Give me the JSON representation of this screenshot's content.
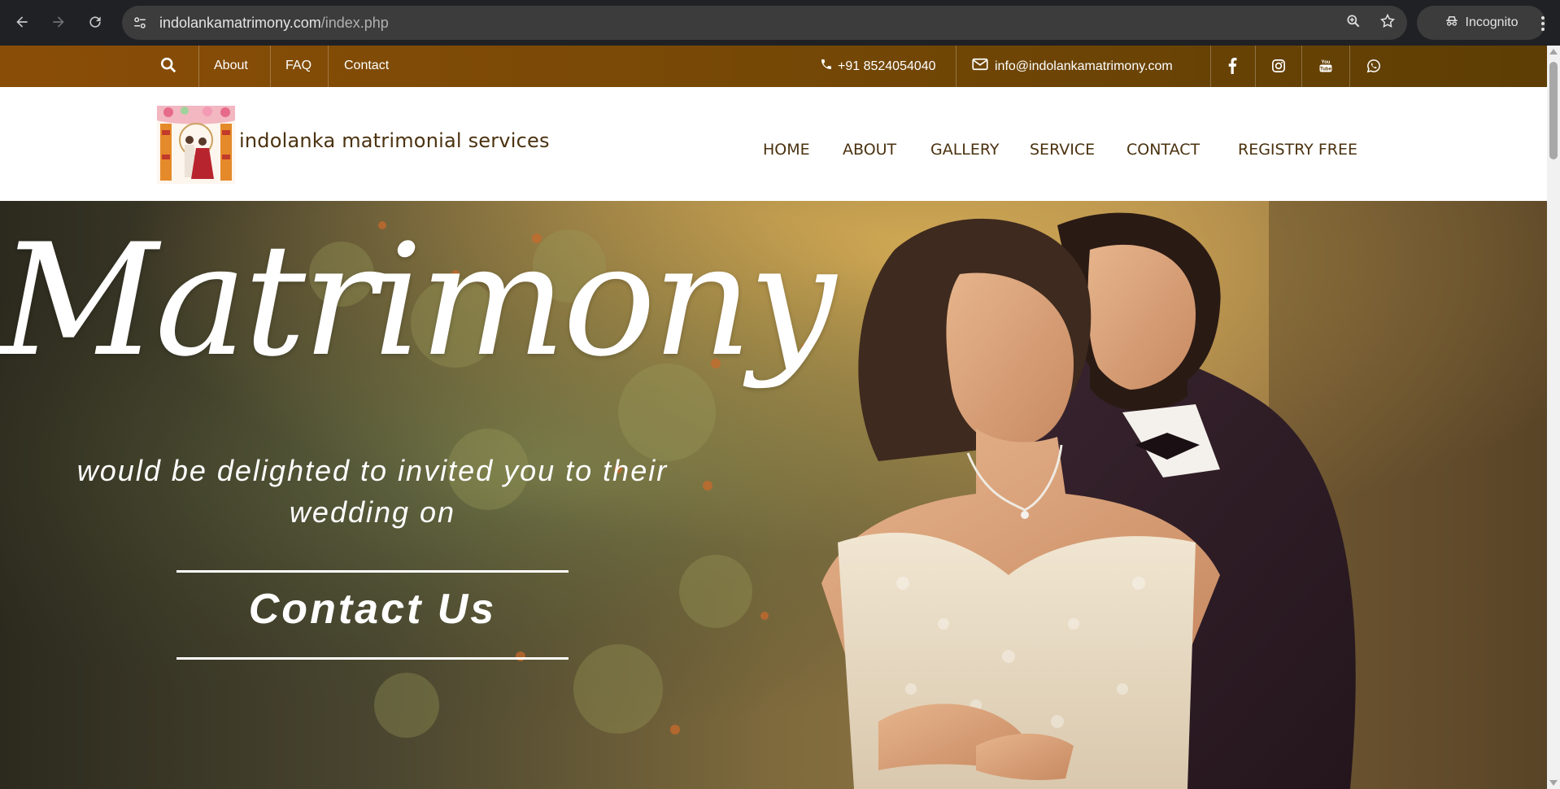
{
  "browser": {
    "url_domain": "indolankamatrimony.com",
    "url_path": "/index.php",
    "incognito_label": "Incognito",
    "icons": [
      "back-icon",
      "forward-icon",
      "reload-icon",
      "site-info-icon",
      "zoom-icon",
      "bookmark-star-icon",
      "incognito-icon",
      "kebab-menu-icon"
    ]
  },
  "topbar": {
    "links": [
      "About",
      "FAQ",
      "Contact"
    ],
    "phone": "+91 8524054040",
    "email": "info@indolankamatrimony.com",
    "social": [
      "facebook-icon",
      "instagram-icon",
      "youtube-icon",
      "whatsapp-icon"
    ],
    "colors": {
      "start": "#8a4d07",
      "end": "#5e3e04"
    }
  },
  "header": {
    "brand": "indolanka matrimonial services",
    "menu": [
      "HOME",
      "ABOUT",
      "GALLERY",
      "SERVICE",
      "CONTACT",
      "REGISTRY FREE"
    ],
    "text_color": "#4b3210"
  },
  "hero": {
    "title": "Matrimony",
    "subtitle": "would be delighted to invited you to their wedding on",
    "cta": "Contact Us"
  }
}
